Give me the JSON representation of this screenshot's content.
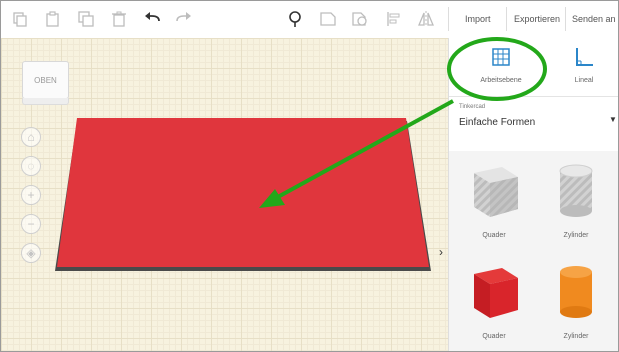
{
  "toolbar": {
    "tools": [
      "copy-icon",
      "paste-icon",
      "duplicate-icon",
      "trash-icon",
      "undo-icon",
      "redo-icon",
      "lightbulb-icon",
      "shape-icon",
      "shape-duplicate-icon",
      "align-icon",
      "mirror-icon"
    ],
    "import_label": "Import",
    "export_label": "Exportieren",
    "send_label": "Senden an"
  },
  "viewcube": {
    "label": "OBEN"
  },
  "nav_controls": [
    "home-view-icon",
    "fit-view-icon",
    "zoom-in-icon",
    "zoom-out-icon",
    "perspective-icon"
  ],
  "panel": {
    "workplane_label": "Arbeitsebene",
    "ruler_label": "Lineal",
    "library_small": "Tinkercad",
    "library_value": "Einfache Formen",
    "shapes": [
      {
        "label": "Quader",
        "icon": "box-striped-icon"
      },
      {
        "label": "Zylinder",
        "icon": "cylinder-striped-icon"
      },
      {
        "label": "Quader",
        "icon": "box-red-icon"
      },
      {
        "label": "Zylinder",
        "icon": "cylinder-orange-icon"
      }
    ]
  },
  "colors": {
    "workplane_red": "#e0363d",
    "annotation_green": "#23a81a",
    "grid_background": "#f7f2df",
    "accent_blue": "#2b86c9"
  }
}
